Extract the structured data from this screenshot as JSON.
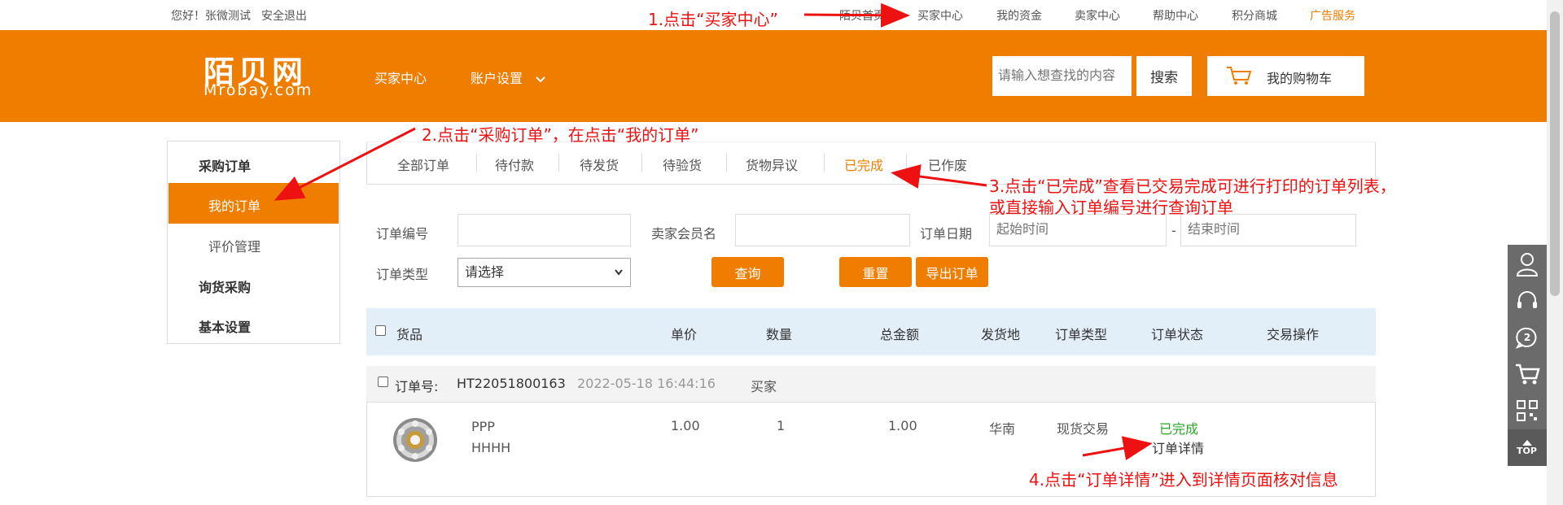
{
  "topbar": {
    "greeting": "您好！张微测试",
    "logout": "安全退出",
    "links": [
      "陌贝首页",
      "买家中心",
      "我的资金",
      "卖家中心",
      "帮助中心",
      "积分商城",
      "广告服务"
    ]
  },
  "header": {
    "logo_cn": "陌贝网",
    "logo_en": "Mrobay.com",
    "nav_buyer_center": "买家中心",
    "nav_account_settings": "账户设置",
    "search_placeholder": "请输入想查找的内容",
    "search_button": "搜索",
    "cart_button": "我的购物车"
  },
  "sidebar": {
    "group_purchase": "采购订单",
    "item_my_orders": "我的订单",
    "item_reviews": "评价管理",
    "group_inquiry": "询货采购",
    "group_basic": "基本设置"
  },
  "tabs": [
    "全部订单",
    "待付款",
    "待发货",
    "待验货",
    "货物异议",
    "已完成",
    "已作废"
  ],
  "filters": {
    "order_no_label": "订单编号",
    "seller_label": "卖家会员名",
    "order_date_label": "订单日期",
    "start_placeholder": "起始时间",
    "dash": "-",
    "end_placeholder": "结束时间",
    "order_type_label": "订单类型",
    "order_type_value": "请选择",
    "query_button": "查询",
    "reset_button": "重置",
    "export_button": "导出订单"
  },
  "table": {
    "headers": [
      "货品",
      "单价",
      "数量",
      "总金额",
      "发货地",
      "订单类型",
      "订单状态",
      "交易操作"
    ]
  },
  "order": {
    "order_no_label": "订单号:",
    "order_no": "HT22051800163",
    "time": "2022-05-18 16:44:16",
    "role": "买家",
    "product_line1": "PPP",
    "product_line2": "HHHH",
    "unit_price": "1.00",
    "quantity": "1",
    "total": "1.00",
    "origin": "华南",
    "order_type": "现货交易",
    "status": "已完成",
    "detail_link": "订单详情"
  },
  "annotations": {
    "step1": "1.点击“买家中心”",
    "step2": "2.点击“采购订单”，在点击“我的订单”",
    "step3_line1": "3.点击“已完成”查看已交易完成可进行打印的订单列表，",
    "step3_line2": "或直接输入订单编号进行查询订单",
    "step4": "4.点击“订单详情”进入到详情页面核对信息"
  },
  "right_panel": {
    "icons": [
      "user-icon",
      "headset-icon",
      "message-count-icon",
      "cart-icon",
      "qr-code-icon",
      "top-icon"
    ],
    "message_count": "2",
    "top_label": "TOP"
  },
  "colors": {
    "brand_orange": "#ef7d00",
    "annotation_red": "#ee1111",
    "status_green": "#2aa52a",
    "table_header_bg": "#e2eef8"
  }
}
